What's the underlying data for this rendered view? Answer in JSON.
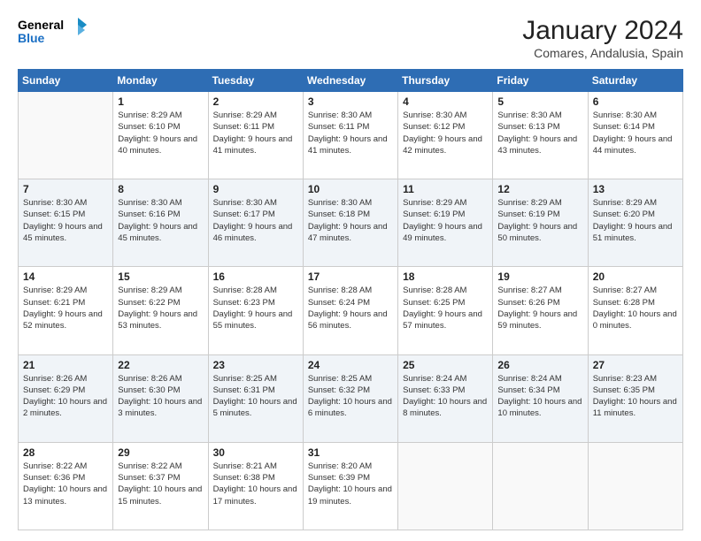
{
  "header": {
    "logo_line1": "General",
    "logo_line2": "Blue",
    "month_title": "January 2024",
    "location": "Comares, Andalusia, Spain"
  },
  "days_of_week": [
    "Sunday",
    "Monday",
    "Tuesday",
    "Wednesday",
    "Thursday",
    "Friday",
    "Saturday"
  ],
  "weeks": [
    [
      {
        "day": null
      },
      {
        "day": "1",
        "sunrise": "Sunrise: 8:29 AM",
        "sunset": "Sunset: 6:10 PM",
        "daylight": "Daylight: 9 hours and 40 minutes."
      },
      {
        "day": "2",
        "sunrise": "Sunrise: 8:29 AM",
        "sunset": "Sunset: 6:11 PM",
        "daylight": "Daylight: 9 hours and 41 minutes."
      },
      {
        "day": "3",
        "sunrise": "Sunrise: 8:30 AM",
        "sunset": "Sunset: 6:11 PM",
        "daylight": "Daylight: 9 hours and 41 minutes."
      },
      {
        "day": "4",
        "sunrise": "Sunrise: 8:30 AM",
        "sunset": "Sunset: 6:12 PM",
        "daylight": "Daylight: 9 hours and 42 minutes."
      },
      {
        "day": "5",
        "sunrise": "Sunrise: 8:30 AM",
        "sunset": "Sunset: 6:13 PM",
        "daylight": "Daylight: 9 hours and 43 minutes."
      },
      {
        "day": "6",
        "sunrise": "Sunrise: 8:30 AM",
        "sunset": "Sunset: 6:14 PM",
        "daylight": "Daylight: 9 hours and 44 minutes."
      }
    ],
    [
      {
        "day": "7",
        "sunrise": "Sunrise: 8:30 AM",
        "sunset": "Sunset: 6:15 PM",
        "daylight": "Daylight: 9 hours and 45 minutes."
      },
      {
        "day": "8",
        "sunrise": "Sunrise: 8:30 AM",
        "sunset": "Sunset: 6:16 PM",
        "daylight": "Daylight: 9 hours and 45 minutes."
      },
      {
        "day": "9",
        "sunrise": "Sunrise: 8:30 AM",
        "sunset": "Sunset: 6:17 PM",
        "daylight": "Daylight: 9 hours and 46 minutes."
      },
      {
        "day": "10",
        "sunrise": "Sunrise: 8:30 AM",
        "sunset": "Sunset: 6:18 PM",
        "daylight": "Daylight: 9 hours and 47 minutes."
      },
      {
        "day": "11",
        "sunrise": "Sunrise: 8:29 AM",
        "sunset": "Sunset: 6:19 PM",
        "daylight": "Daylight: 9 hours and 49 minutes."
      },
      {
        "day": "12",
        "sunrise": "Sunrise: 8:29 AM",
        "sunset": "Sunset: 6:19 PM",
        "daylight": "Daylight: 9 hours and 50 minutes."
      },
      {
        "day": "13",
        "sunrise": "Sunrise: 8:29 AM",
        "sunset": "Sunset: 6:20 PM",
        "daylight": "Daylight: 9 hours and 51 minutes."
      }
    ],
    [
      {
        "day": "14",
        "sunrise": "Sunrise: 8:29 AM",
        "sunset": "Sunset: 6:21 PM",
        "daylight": "Daylight: 9 hours and 52 minutes."
      },
      {
        "day": "15",
        "sunrise": "Sunrise: 8:29 AM",
        "sunset": "Sunset: 6:22 PM",
        "daylight": "Daylight: 9 hours and 53 minutes."
      },
      {
        "day": "16",
        "sunrise": "Sunrise: 8:28 AM",
        "sunset": "Sunset: 6:23 PM",
        "daylight": "Daylight: 9 hours and 55 minutes."
      },
      {
        "day": "17",
        "sunrise": "Sunrise: 8:28 AM",
        "sunset": "Sunset: 6:24 PM",
        "daylight": "Daylight: 9 hours and 56 minutes."
      },
      {
        "day": "18",
        "sunrise": "Sunrise: 8:28 AM",
        "sunset": "Sunset: 6:25 PM",
        "daylight": "Daylight: 9 hours and 57 minutes."
      },
      {
        "day": "19",
        "sunrise": "Sunrise: 8:27 AM",
        "sunset": "Sunset: 6:26 PM",
        "daylight": "Daylight: 9 hours and 59 minutes."
      },
      {
        "day": "20",
        "sunrise": "Sunrise: 8:27 AM",
        "sunset": "Sunset: 6:28 PM",
        "daylight": "Daylight: 10 hours and 0 minutes."
      }
    ],
    [
      {
        "day": "21",
        "sunrise": "Sunrise: 8:26 AM",
        "sunset": "Sunset: 6:29 PM",
        "daylight": "Daylight: 10 hours and 2 minutes."
      },
      {
        "day": "22",
        "sunrise": "Sunrise: 8:26 AM",
        "sunset": "Sunset: 6:30 PM",
        "daylight": "Daylight: 10 hours and 3 minutes."
      },
      {
        "day": "23",
        "sunrise": "Sunrise: 8:25 AM",
        "sunset": "Sunset: 6:31 PM",
        "daylight": "Daylight: 10 hours and 5 minutes."
      },
      {
        "day": "24",
        "sunrise": "Sunrise: 8:25 AM",
        "sunset": "Sunset: 6:32 PM",
        "daylight": "Daylight: 10 hours and 6 minutes."
      },
      {
        "day": "25",
        "sunrise": "Sunrise: 8:24 AM",
        "sunset": "Sunset: 6:33 PM",
        "daylight": "Daylight: 10 hours and 8 minutes."
      },
      {
        "day": "26",
        "sunrise": "Sunrise: 8:24 AM",
        "sunset": "Sunset: 6:34 PM",
        "daylight": "Daylight: 10 hours and 10 minutes."
      },
      {
        "day": "27",
        "sunrise": "Sunrise: 8:23 AM",
        "sunset": "Sunset: 6:35 PM",
        "daylight": "Daylight: 10 hours and 11 minutes."
      }
    ],
    [
      {
        "day": "28",
        "sunrise": "Sunrise: 8:22 AM",
        "sunset": "Sunset: 6:36 PM",
        "daylight": "Daylight: 10 hours and 13 minutes."
      },
      {
        "day": "29",
        "sunrise": "Sunrise: 8:22 AM",
        "sunset": "Sunset: 6:37 PM",
        "daylight": "Daylight: 10 hours and 15 minutes."
      },
      {
        "day": "30",
        "sunrise": "Sunrise: 8:21 AM",
        "sunset": "Sunset: 6:38 PM",
        "daylight": "Daylight: 10 hours and 17 minutes."
      },
      {
        "day": "31",
        "sunrise": "Sunrise: 8:20 AM",
        "sunset": "Sunset: 6:39 PM",
        "daylight": "Daylight: 10 hours and 19 minutes."
      },
      {
        "day": null
      },
      {
        "day": null
      },
      {
        "day": null
      }
    ]
  ]
}
